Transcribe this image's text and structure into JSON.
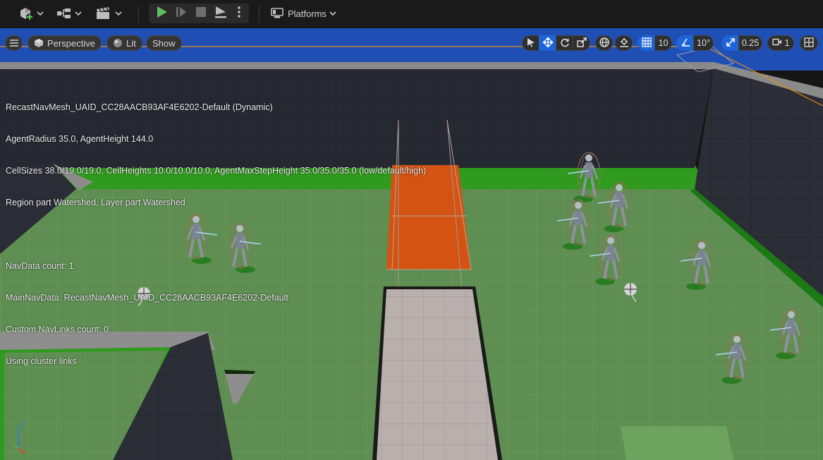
{
  "toolbar": {
    "items": [
      {
        "name": "add-actor-icon"
      },
      {
        "name": "blueprint-icon"
      },
      {
        "name": "cinematics-icon"
      }
    ],
    "play_controls": [
      {
        "name": "play-icon",
        "color": "#5ec05e"
      },
      {
        "name": "advance-frame-icon"
      },
      {
        "name": "stop-icon"
      },
      {
        "name": "eject-icon"
      },
      {
        "name": "more-options-icon"
      }
    ],
    "platforms_label": "Platforms"
  },
  "viewport": {
    "menu_icon": "hamburger-icon",
    "view_mode_label": "Perspective",
    "lit_label": "Lit",
    "show_label": "Show",
    "grid_snap_value": "10",
    "rotation_snap_value": "10°",
    "scale_snap_value": "0.25",
    "camera_speed_value": "1",
    "active_color": "#1d64d8"
  },
  "debug": {
    "lines": [
      "RecastNavMesh_UAID_CC28AACB93AF4E6202-Default (Dynamic)",
      "AgentRadius 35.0, AgentHeight 144.0",
      "CellSizes 38.0/19.0/19.0, CellHeights 10.0/10.0/10.0, AgentMaxStepHeight 35.0/35.0/35.0 (low/default/high)",
      "Region part Watershed, Layer part Watershed",
      "",
      "NavData count: 1",
      "MainNavData: RecastNavMesh_UAID_CC28AACB93AF4E6202-Default",
      "Custom NavLinks count: 0",
      "Using cluster links"
    ]
  },
  "axis": {
    "z_label": "z",
    "x_label": "x"
  },
  "scene_colors": {
    "sky": "#1f4fb4",
    "floor": "#5e8e52",
    "navmesh_border": "#2f9a1d",
    "wall": "#262931",
    "orange_area": "#d45312",
    "walkway": "#b9b0ae"
  }
}
